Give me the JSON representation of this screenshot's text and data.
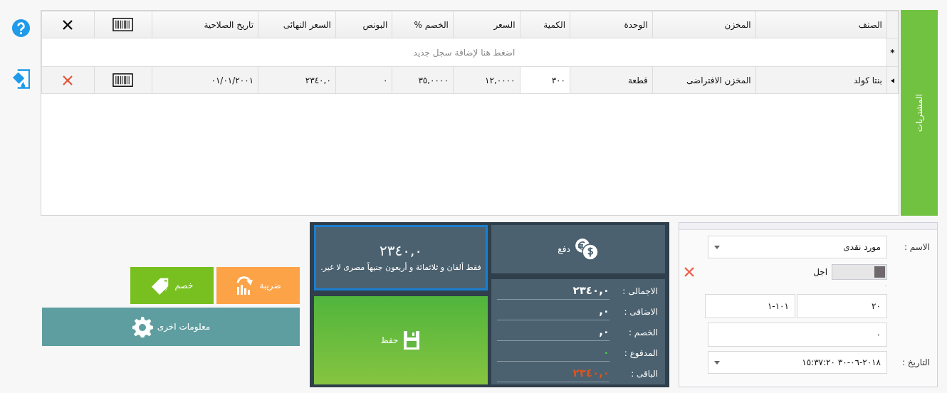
{
  "side_tab": {
    "label": "المشتريات"
  },
  "grid": {
    "columns": [
      {
        "kind": "text",
        "label": "الصنف"
      },
      {
        "kind": "text",
        "label": "المخزن"
      },
      {
        "kind": "text",
        "label": "الوحدة"
      },
      {
        "kind": "text",
        "label": "الكمية"
      },
      {
        "kind": "text",
        "label": "السعر"
      },
      {
        "kind": "text",
        "label": "الخصم %"
      },
      {
        "kind": "text",
        "label": "البونص"
      },
      {
        "kind": "text",
        "label": "السعر النهائى"
      },
      {
        "kind": "text",
        "label": "تاريخ الصلاحية"
      },
      {
        "kind": "barcode"
      },
      {
        "kind": "delete"
      }
    ],
    "new_row": {
      "marker": "*",
      "placeholder": "اضغط هنا لإضافة سجل جديد"
    },
    "rows": [
      {
        "selected": true,
        "cells": [
          "بنتا كولد",
          "المخزن الافتراضى",
          "قطعة",
          "٣٠٠",
          "١٢,٠٠٠٠",
          "٣٥,٠٠٠٠",
          "٠",
          "٢٣٤٠,٠",
          "٠١/٠١/٢٠٠١"
        ]
      }
    ]
  },
  "amount": {
    "focused": true,
    "value": "٢٣٤٠,٠",
    "words": "فقط ألفان و ثلاثمائة و أربعون جنيهاً مصرى لا غير."
  },
  "pay_button": "دفع",
  "save_button": "حفظ",
  "summary": [
    {
      "label": "الاجمالى :",
      "value": "٢٣٤٠,٠",
      "color": "#ffffff"
    },
    {
      "label": "الاضافى :",
      "value": "٠,",
      "color": "#ffffff"
    },
    {
      "label": "الخصم :",
      "value": "٠,",
      "color": "#ffffff"
    },
    {
      "label": "المدفوع :",
      "value": "٠",
      "color": "#3ecf3e"
    },
    {
      "label": "الباقى :",
      "value": "٢٣٤٠,٠",
      "color": "#e0531c"
    }
  ],
  "actions": {
    "tax": "ضريبة",
    "discount": "خصم",
    "more": "معلومات اخرى"
  },
  "form": {
    "name_label": "الاسم :",
    "name_value": "مورد نقدى",
    "deferred": {
      "label": "اجل",
      "on": false
    },
    "paid_mark": "٠",
    "field_a": "٢٠",
    "field_b": "١-١٠١",
    "field_c": "٠",
    "date_label": "التاريخ :",
    "date_value": "١٥:٣٧:٢٠ ٣٠-٠٦-٢٠١٨"
  }
}
